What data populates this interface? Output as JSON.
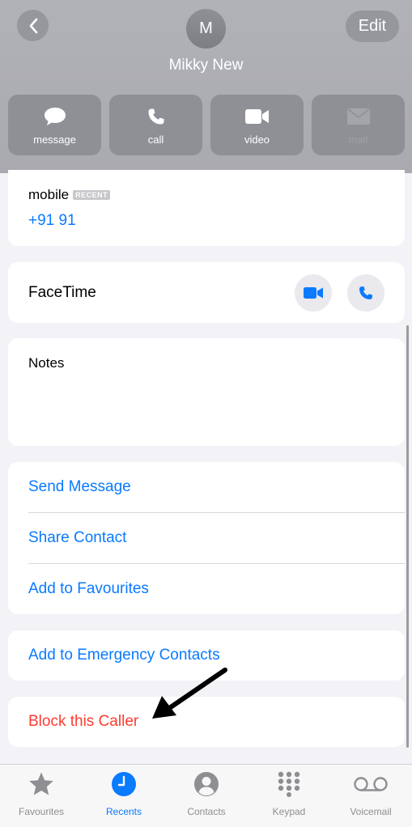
{
  "header": {
    "avatar_initial": "M",
    "contact_name": "Mikky New",
    "edit_label": "Edit"
  },
  "actions": [
    {
      "label": "message",
      "icon": "message-bubble-icon"
    },
    {
      "label": "call",
      "icon": "phone-icon"
    },
    {
      "label": "video",
      "icon": "video-camera-icon"
    },
    {
      "label": "mail",
      "icon": "envelope-icon",
      "disabled": true
    }
  ],
  "phone": {
    "label": "mobile",
    "badge": "RECENT",
    "number": "+91 91"
  },
  "facetime": {
    "label": "FaceTime"
  },
  "notes": {
    "label": "Notes"
  },
  "menu": {
    "send_message": "Send Message",
    "share_contact": "Share Contact",
    "add_favourites": "Add to Favourites"
  },
  "emergency": {
    "label": "Add to Emergency Contacts"
  },
  "block": {
    "label": "Block this Caller"
  },
  "tabs": [
    {
      "label": "Favourites",
      "icon": "star-icon"
    },
    {
      "label": "Recents",
      "icon": "clock-icon",
      "active": true
    },
    {
      "label": "Contacts",
      "icon": "person-circle-icon"
    },
    {
      "label": "Keypad",
      "icon": "keypad-grid-icon"
    },
    {
      "label": "Voicemail",
      "icon": "voicemail-icon"
    }
  ],
  "colors": {
    "accent": "#0a7aff",
    "destructive": "#ff3b30",
    "header_bg": "#b1b2b7",
    "action_bg": "#8e9096",
    "annotation_arrow": "#000000"
  }
}
